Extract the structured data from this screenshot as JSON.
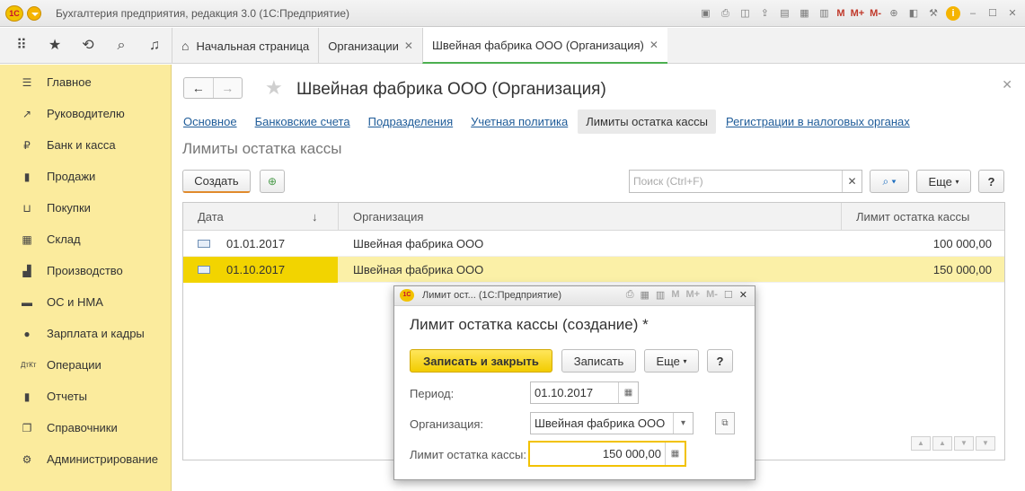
{
  "app": {
    "title": "Бухгалтерия предприятия, редакция 3.0  (1С:Предприятие)",
    "logo": "1С",
    "toolbar_icons": {
      "m": "M",
      "m_plus": "M+",
      "m_minus": "M-"
    }
  },
  "tabs": [
    {
      "label": "Начальная страница"
    },
    {
      "label": "Организации"
    },
    {
      "label": "Швейная фабрика ООО (Организация)"
    }
  ],
  "sidebar": {
    "items": [
      {
        "label": "Главное",
        "icon": "menu-lines-icon"
      },
      {
        "label": "Руководителю",
        "icon": "trend-icon"
      },
      {
        "label": "Банк и касса",
        "icon": "ruble-icon"
      },
      {
        "label": "Продажи",
        "icon": "bag-icon"
      },
      {
        "label": "Покупки",
        "icon": "cart-icon"
      },
      {
        "label": "Склад",
        "icon": "warehouse-icon"
      },
      {
        "label": "Производство",
        "icon": "factory-icon"
      },
      {
        "label": "ОС и НМА",
        "icon": "truck-icon"
      },
      {
        "label": "Зарплата и кадры",
        "icon": "person-icon"
      },
      {
        "label": "Операции",
        "icon": "dt-kt-icon"
      },
      {
        "label": "Отчеты",
        "icon": "bar-chart-icon"
      },
      {
        "label": "Справочники",
        "icon": "book-icon"
      },
      {
        "label": "Администрирование",
        "icon": "gear-icon"
      }
    ]
  },
  "main": {
    "title": "Швейная фабрика ООО (Организация)",
    "links": [
      {
        "label": "Основное"
      },
      {
        "label": "Банковские счета"
      },
      {
        "label": "Подразделения"
      },
      {
        "label": "Учетная политика"
      },
      {
        "label": "Лимиты остатка кассы",
        "current": true
      },
      {
        "label": "Регистрации в налоговых органах"
      }
    ],
    "section_title": "Лимиты остатка кассы",
    "create_label": "Создать",
    "search_placeholder": "Поиск (Ctrl+F)",
    "more_label": "Еще",
    "help_label": "?"
  },
  "table": {
    "columns": [
      "Дата",
      "Организация",
      "Лимит остатка кассы"
    ],
    "sort_indicator": "↓",
    "rows": [
      {
        "date": "01.01.2017",
        "org": "Швейная фабрика ООО",
        "limit": "100 000,00"
      },
      {
        "date": "01.10.2017",
        "org": "Швейная фабрика ООО",
        "limit": "150 000,00",
        "selected": true
      }
    ]
  },
  "dialog": {
    "bar_title": "Лимит ост...  (1С:Предприятие)",
    "title": "Лимит остатка кассы (создание) *",
    "save_close_label": "Записать и закрыть",
    "save_label": "Записать",
    "more_label": "Еще",
    "help_label": "?",
    "period_label": "Период:",
    "period_value": "01.10.2017",
    "org_label": "Организация:",
    "org_value": "Швейная фабрика ООО",
    "limit_label": "Лимит остатка кассы:",
    "limit_value": "150 000,00"
  },
  "colors": {
    "sidebar_bg": "#fbeb9d",
    "selected_row": "#fbf0a7",
    "accent_yellow": "#f2c200",
    "link_blue": "#1f5c99"
  }
}
